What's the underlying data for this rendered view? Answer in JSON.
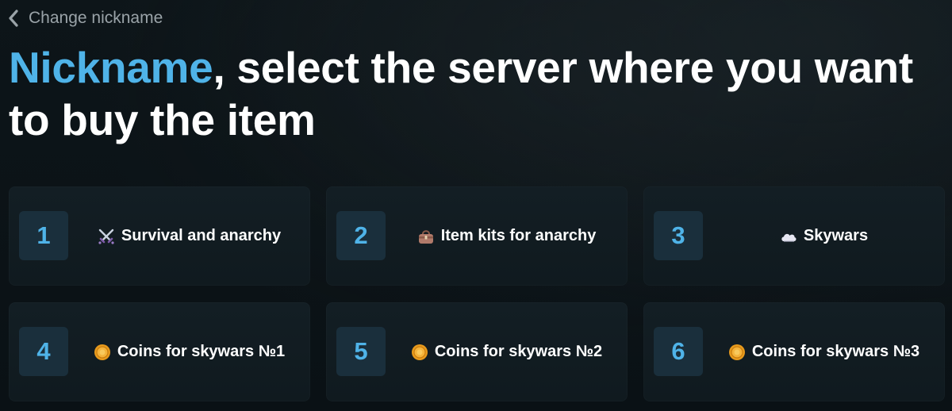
{
  "header": {
    "back_label": "Change nickname",
    "title_accent": "Nickname",
    "title_rest": ", select the server where you want to buy the item"
  },
  "servers": [
    {
      "number": "1",
      "icon": "crossed-swords-icon",
      "label": "Survival and anarchy"
    },
    {
      "number": "2",
      "icon": "bag-icon",
      "label": "Item kits for anarchy"
    },
    {
      "number": "3",
      "icon": "cloud-icon",
      "label": "Skywars"
    },
    {
      "number": "4",
      "icon": "coin-icon",
      "label": "Coins for skywars №1"
    },
    {
      "number": "5",
      "icon": "coin-icon",
      "label": "Coins for skywars №2"
    },
    {
      "number": "6",
      "icon": "coin-icon",
      "label": "Coins for skywars №3"
    }
  ],
  "colors": {
    "accent": "#4fb3e8",
    "background": "#0a1115",
    "card": "#121d23",
    "number_tile": "#1a2f3c"
  }
}
